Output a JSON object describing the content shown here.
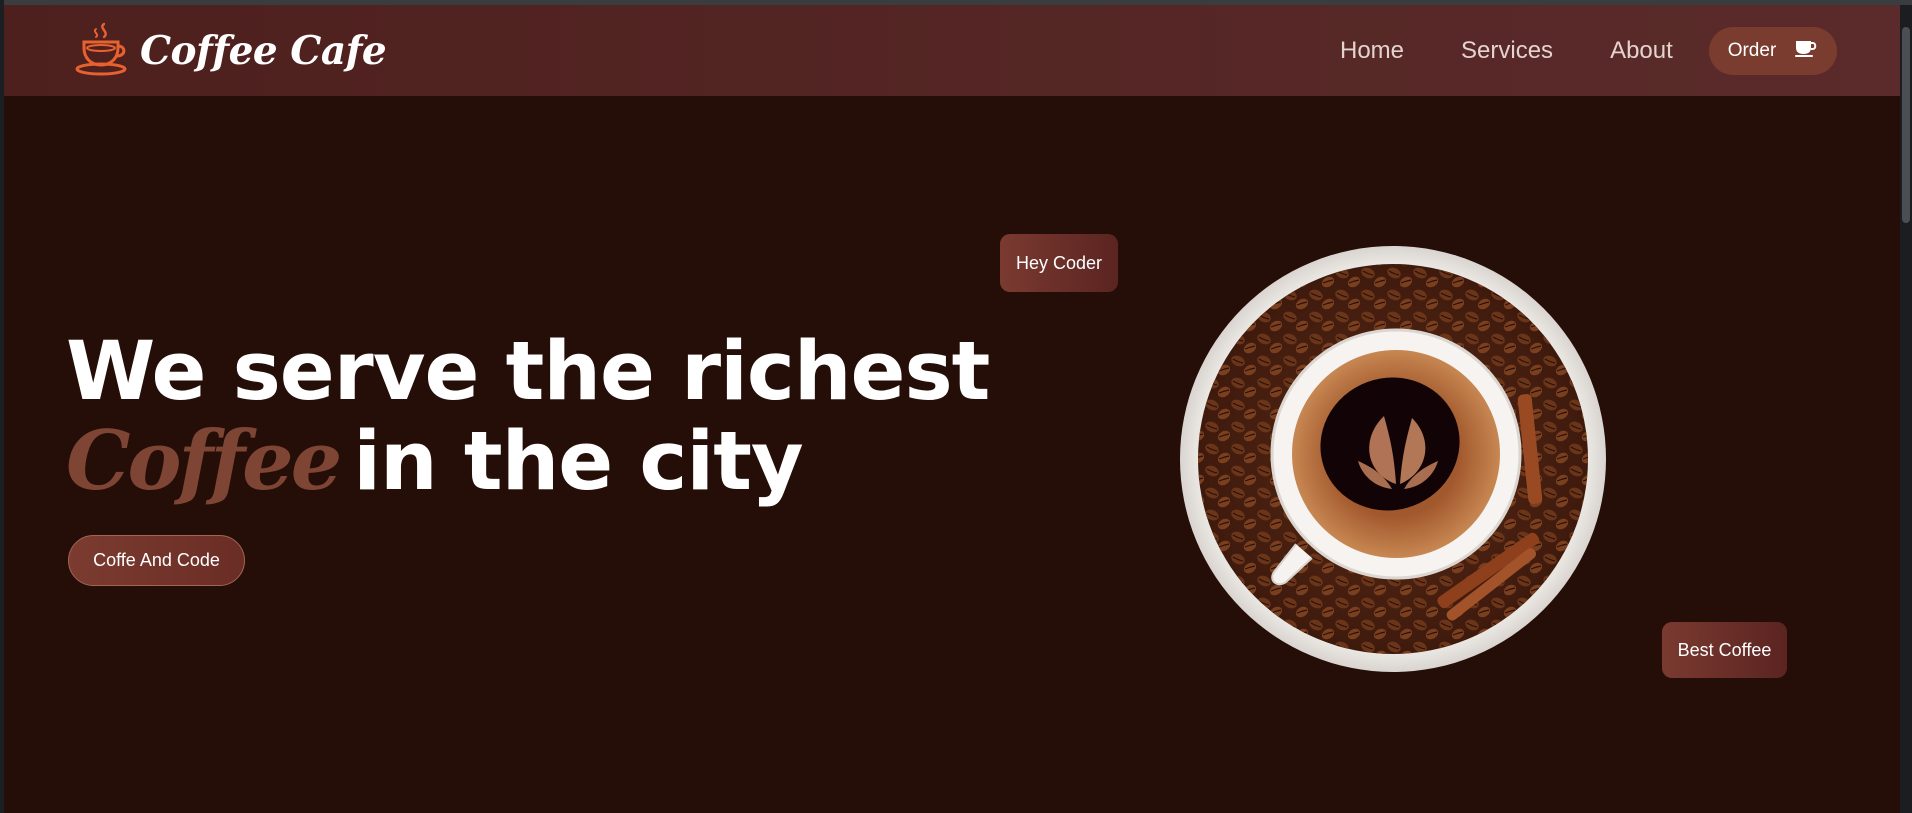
{
  "navbar": {
    "brand": "Coffee Cafe",
    "links": [
      "Home",
      "Services",
      "About"
    ],
    "order_label": "Order"
  },
  "hero": {
    "line1": "We serve the richest",
    "accent": "Coffee",
    "line2_rest": "in the city",
    "button_label": "Coffe And Code"
  },
  "tags": {
    "top": "Hey Coder",
    "bottom": "Best Coffee"
  },
  "icons": {
    "logo": "coffee-cup-logo-icon",
    "order": "coffee-cup-icon"
  },
  "colors": {
    "background": "#240e07",
    "navbar": "#4d1f1d",
    "accent": "#7e4535",
    "logo": "#e8622f"
  }
}
